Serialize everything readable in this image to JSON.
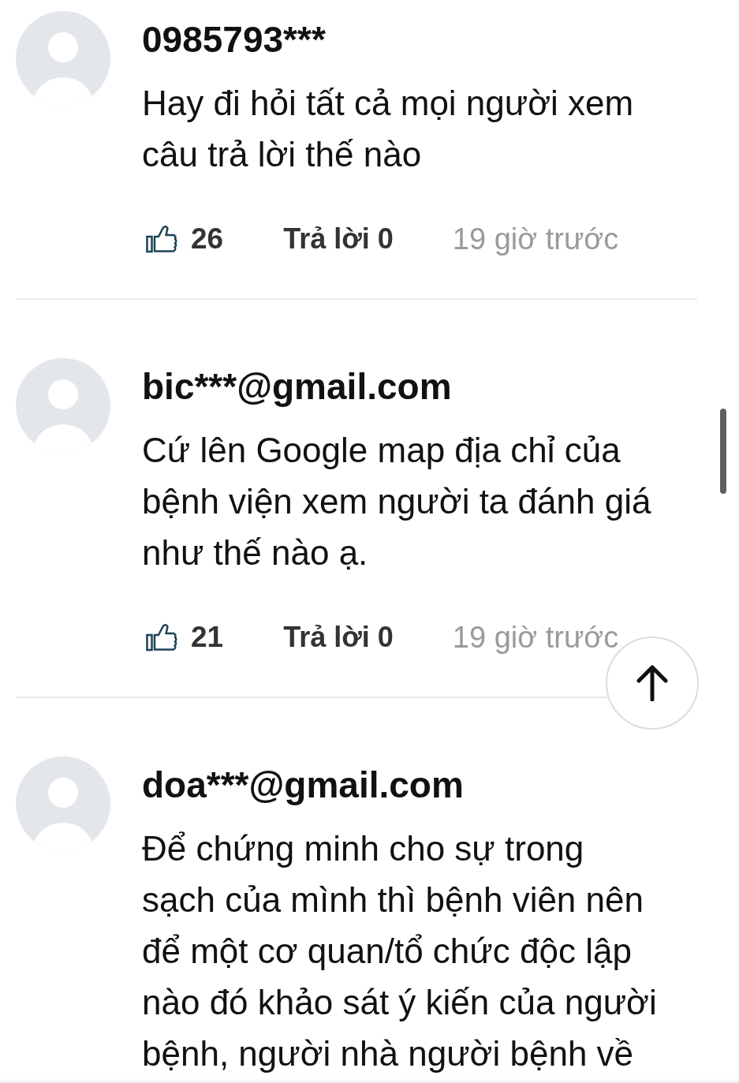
{
  "comments": [
    {
      "author": "0985793***",
      "text": "Hay đi hỏi tất cả mọi người xem câu trả lời thế nào",
      "likes": "26",
      "replies": "Trả lời 0",
      "time": "19 giờ trước"
    },
    {
      "author": "bic***@gmail.com",
      "text": "Cứ lên Google map địa chỉ của bệnh viện xem người ta đánh giá như thế nào ạ.",
      "likes": "21",
      "replies": "Trả lời 0",
      "time": "19 giờ trước"
    },
    {
      "author": "doa***@gmail.com",
      "text": "Để chứng minh cho sự trong sạch của mình thì bệnh viên nên để một cơ quan/tổ chức độc lập nào đó khảo sát ý kiến của người bệnh, người nhà người bệnh về"
    }
  ]
}
